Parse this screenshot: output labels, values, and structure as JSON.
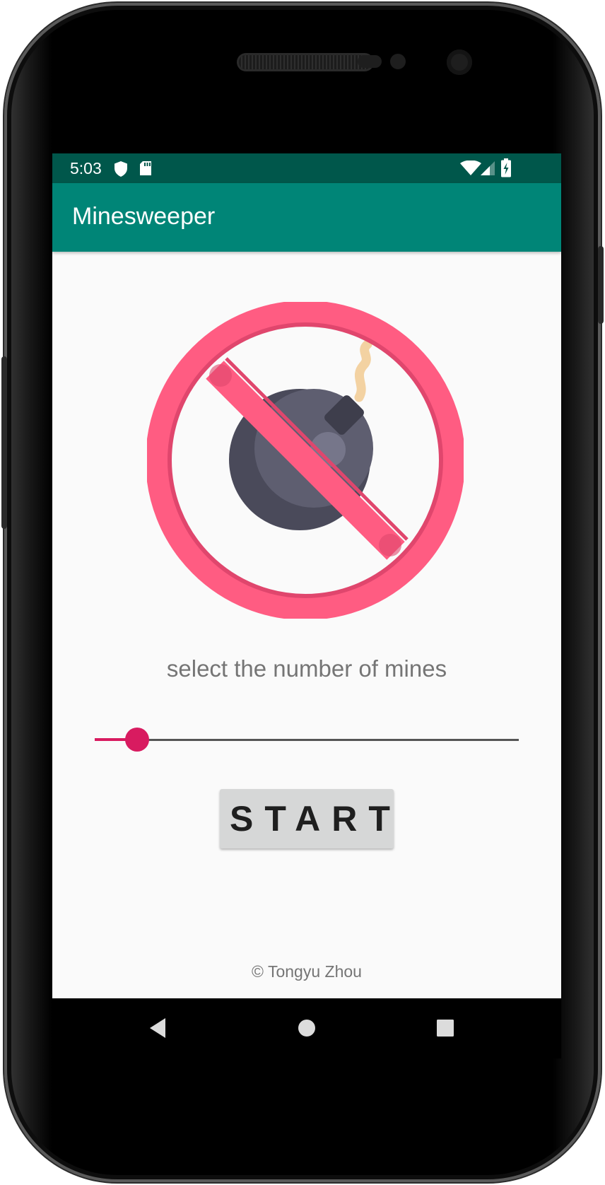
{
  "status_bar": {
    "time": "5:03",
    "icons": [
      "shield-icon",
      "sd-card-icon",
      "wifi-icon",
      "cell-signal-icon",
      "battery-charging-icon"
    ]
  },
  "app_bar": {
    "title": "Minesweeper"
  },
  "main": {
    "hero_image": "no-bomb-icon",
    "prompt": "select the number of mines",
    "slider": {
      "value_fraction": 0.1,
      "accent_color": "#d81b60"
    },
    "start_button_label": "START",
    "copyright": "© Tongyu Zhou"
  },
  "nav_bar": {
    "icons": [
      "back-icon",
      "home-icon",
      "recents-icon"
    ]
  },
  "colors": {
    "status_bar": "#00574b",
    "app_bar": "#008577",
    "accent": "#d81b60",
    "background": "#fafafa"
  }
}
